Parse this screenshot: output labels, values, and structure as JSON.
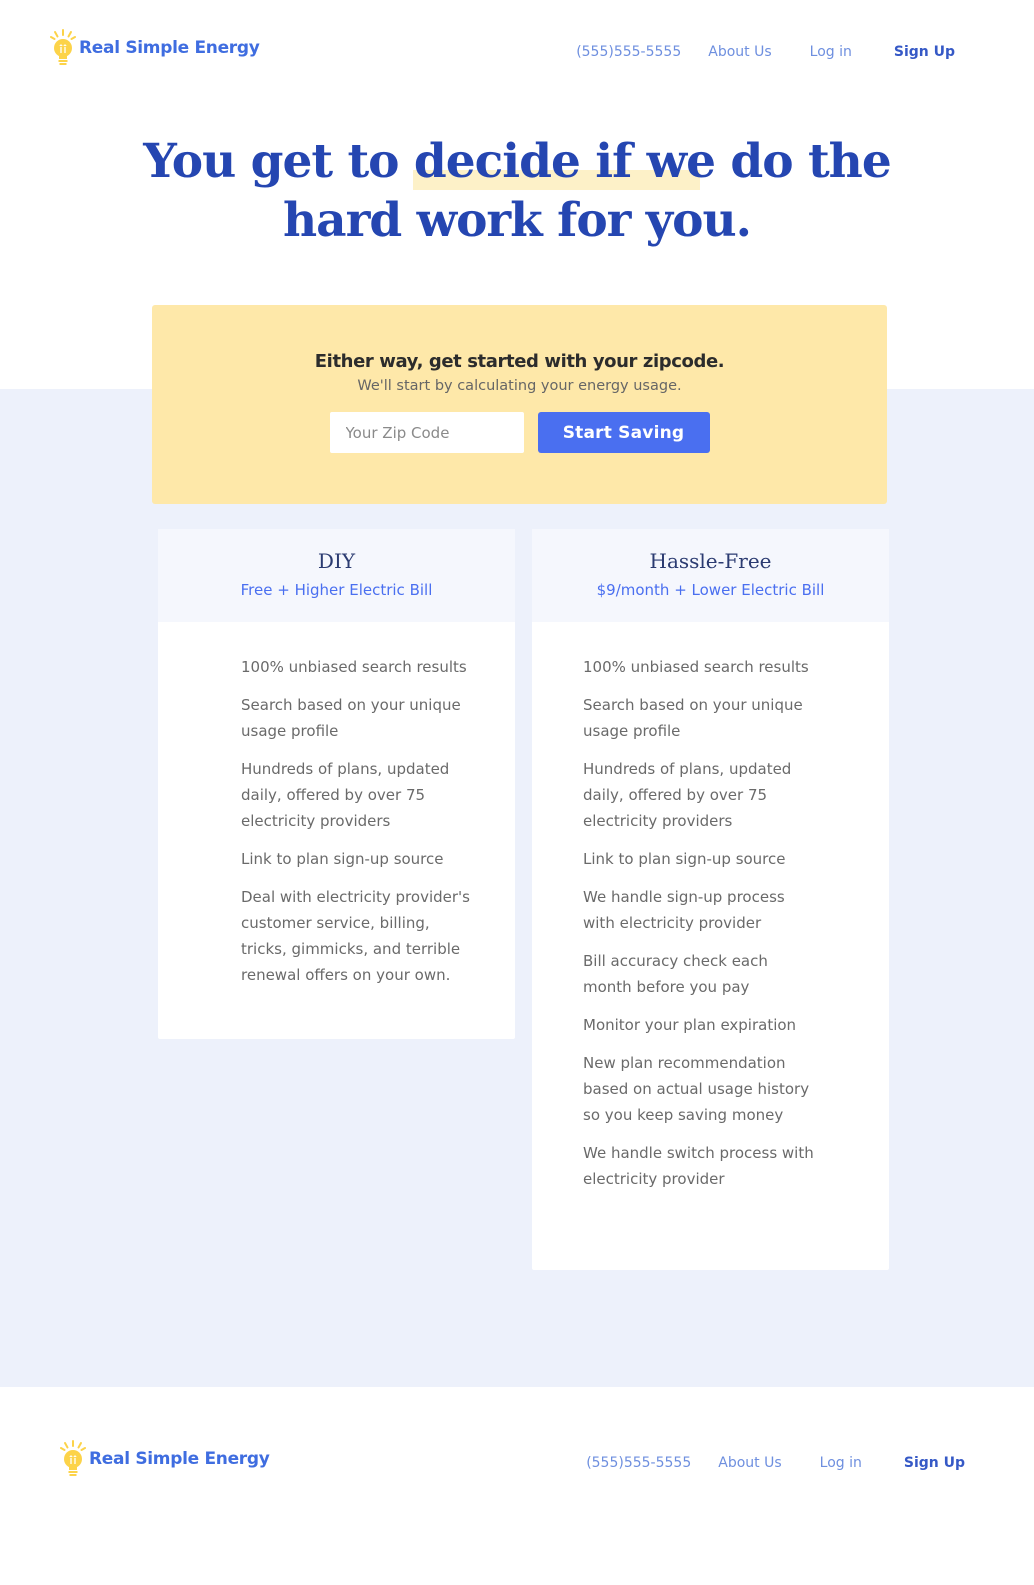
{
  "brand": {
    "name": "Real Simple Energy",
    "colors": {
      "primary": "#3f6de0",
      "accent": "#fcd349",
      "band": "#edf1fb",
      "card": "#fee8a9",
      "button": "#4a6ff0"
    }
  },
  "nav": {
    "phone": "(555)555-5555",
    "about": "About Us",
    "login": "Log in",
    "signup": "Sign Up"
  },
  "hero": {
    "line1": "You get to decide if we do the",
    "line2": "hard work for you."
  },
  "zip": {
    "heading": "Either way, get started with your zipcode.",
    "subheading": "We'll start by calculating your energy usage.",
    "placeholder": "Your Zip Code",
    "value": "",
    "button": "Start Saving"
  },
  "plans": [
    {
      "name": "DIY",
      "price": "Free + Higher Electric Bill",
      "features": [
        "100% unbiased search results",
        "Search based on your unique usage profile",
        "Hundreds of plans, updated daily, offered by over 75 electricity providers",
        "Link to plan sign-up source",
        "Deal with electricity provider's customer service, billing, tricks, gimmicks, and terrible renewal offers on your own."
      ]
    },
    {
      "name": "Hassle-Free",
      "price": "$9/month + Lower Electric Bill",
      "features": [
        "100% unbiased search results",
        "Search based on your unique usage profile",
        "Hundreds of plans, updated daily, offered by over 75 electricity providers",
        "Link to plan sign-up source",
        "We handle sign-up process with electricity provider",
        "Bill accuracy check each month before you pay",
        "Monitor your plan expiration",
        "New plan recommendation based on actual usage history so you keep saving money",
        "We handle switch process with electricity provider"
      ]
    }
  ],
  "icons": {
    "logo": "lightbulb-icon"
  }
}
